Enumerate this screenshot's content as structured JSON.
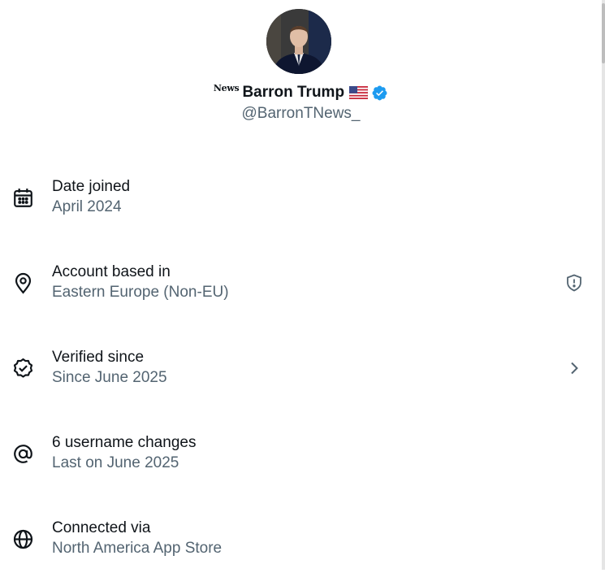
{
  "profile": {
    "news_prefix": "News",
    "display_name": "Barron Trump",
    "flag_emoji_icon": "us-flag-icon",
    "verified_icon": "verified-badge-icon",
    "verified_color": "#1d9bf0",
    "handle": "@BarronTNews_"
  },
  "info": [
    {
      "icon": "calendar-icon",
      "title": "Date joined",
      "subtitle": "April 2024"
    },
    {
      "icon": "location-pin-icon",
      "title": "Account based in",
      "subtitle": "Eastern Europe (Non-EU)",
      "action_icon": "shield-alert-icon"
    },
    {
      "icon": "verified-check-icon",
      "title": "Verified since",
      "subtitle": "Since June 2025",
      "action_icon": "chevron-right-icon"
    },
    {
      "icon": "at-sign-icon",
      "title": "6 username changes",
      "subtitle": "Last on June 2025"
    },
    {
      "icon": "globe-icon",
      "title": "Connected via",
      "subtitle": "North America App Store"
    }
  ],
  "colors": {
    "primary_text": "#0f1419",
    "secondary_text": "#536471"
  }
}
